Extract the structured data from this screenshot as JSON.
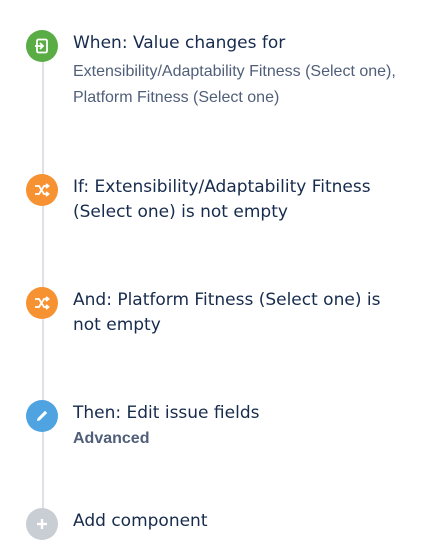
{
  "colors": {
    "trigger": "#5aac44",
    "condition": "#f79232",
    "action": "#4fa3e0",
    "add": "#c9cdd4",
    "line": "#dfe1e6"
  },
  "steps": [
    {
      "type": "trigger",
      "icon": "trigger-enter-icon",
      "title": "When: Value changes for",
      "subtitle": "Extensibility/Adaptability Fitness (Select one), Platform Fitness (Select one)"
    },
    {
      "type": "condition",
      "icon": "shuffle-icon",
      "title": "If: Extensibility/Adaptability Fitness (Select one) is not empty"
    },
    {
      "type": "condition",
      "icon": "shuffle-icon",
      "title": "And: Platform Fitness (Select one) is not empty"
    },
    {
      "type": "action",
      "icon": "pencil-icon",
      "title": "Then: Edit issue fields",
      "detail": "Advanced"
    }
  ],
  "add_component": {
    "icon": "plus-icon",
    "label": "Add component"
  }
}
